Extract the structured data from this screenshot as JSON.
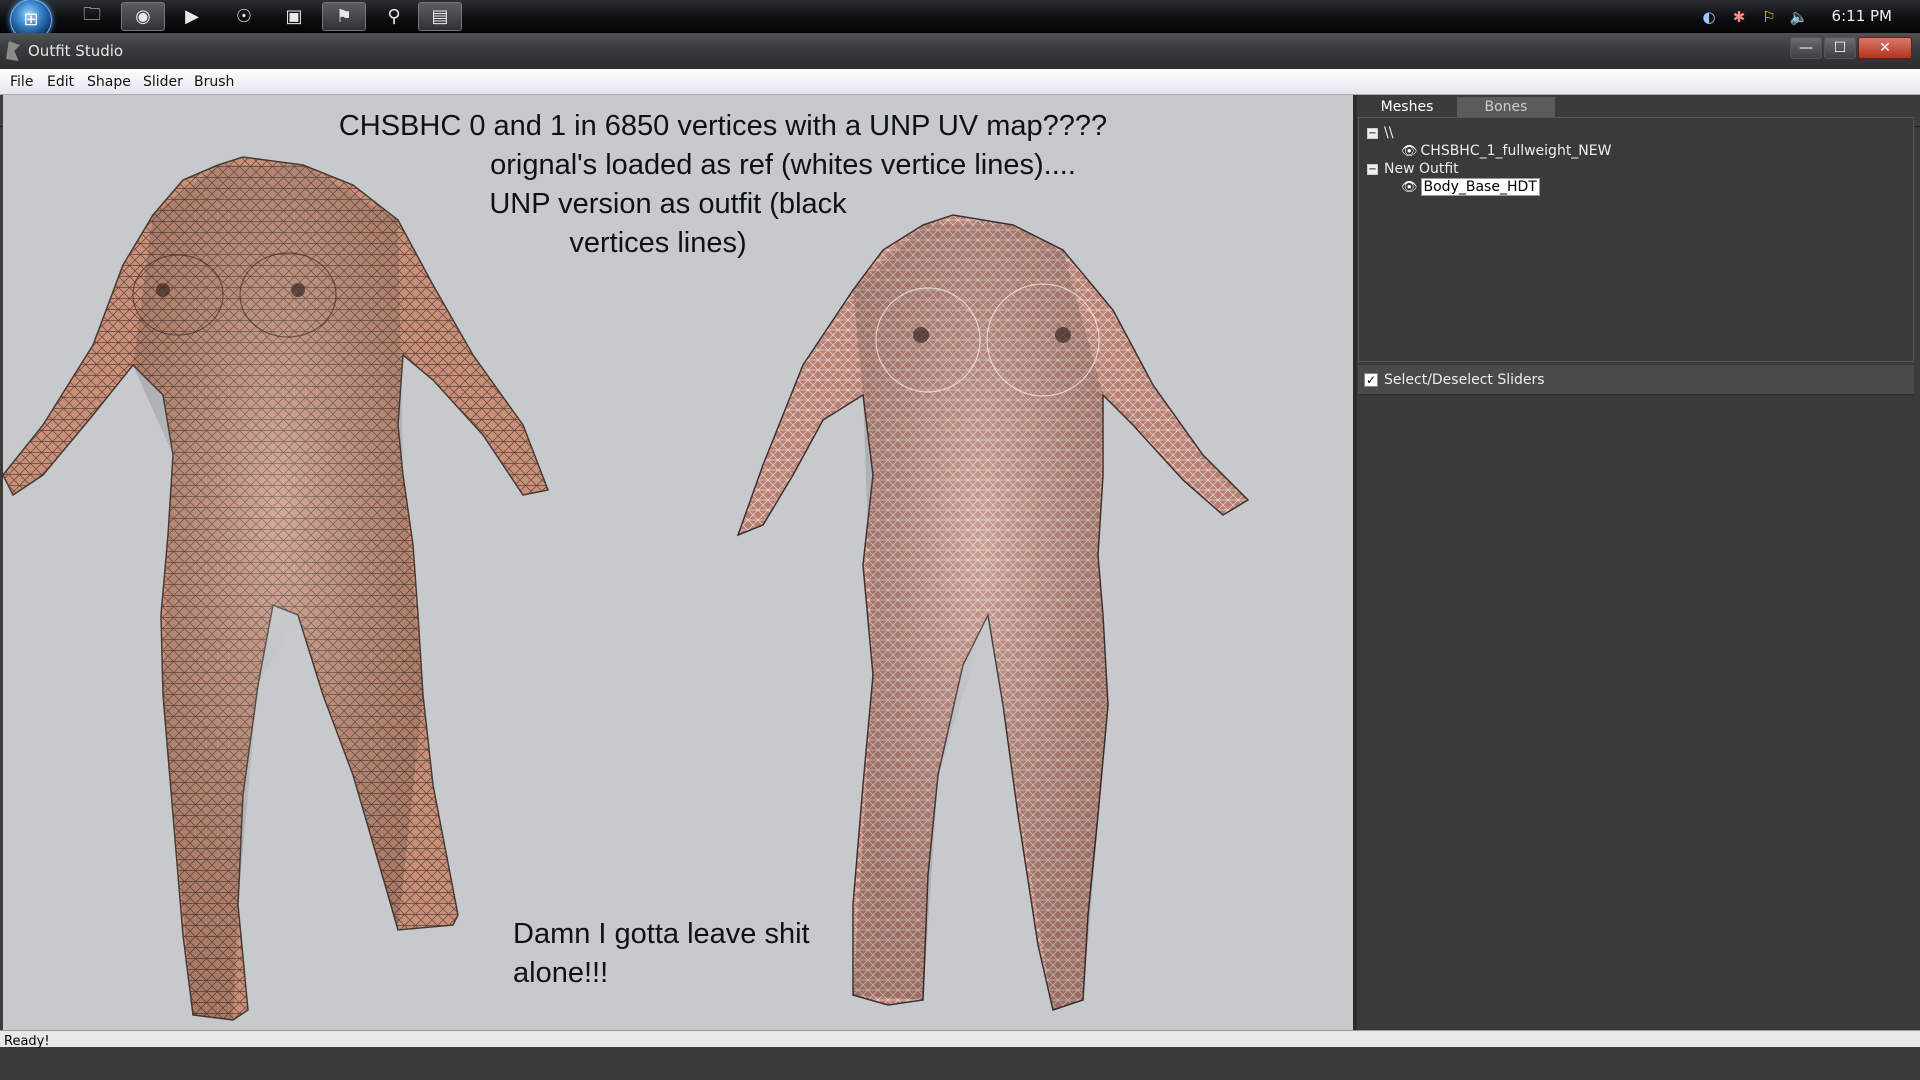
{
  "taskbar": {
    "start_icon": "windows-orb-icon",
    "pinned": [
      {
        "name": "file-explorer-icon",
        "glyph": "🗀"
      },
      {
        "name": "firefox-icon",
        "glyph": "◉"
      },
      {
        "name": "media-player-icon",
        "glyph": "▶"
      },
      {
        "name": "app-c-icon",
        "glyph": "☉"
      },
      {
        "name": "app-window-icon",
        "glyph": "▣"
      },
      {
        "name": "outfit-studio-icon",
        "glyph": "⚑"
      },
      {
        "name": "app-gear-icon",
        "glyph": "⚲"
      },
      {
        "name": "app-monitor-icon",
        "glyph": "▤"
      }
    ],
    "tray": [
      {
        "name": "steam-icon",
        "glyph": "◐"
      },
      {
        "name": "network-status-icon",
        "glyph": "✱"
      },
      {
        "name": "flag-icon",
        "glyph": "⚐"
      },
      {
        "name": "volume-icon",
        "glyph": "🔈"
      }
    ],
    "clock": "6:11 PM"
  },
  "window": {
    "title": "Outfit Studio",
    "controls": {
      "minimize": "—",
      "maximize": "☐",
      "close": "✕"
    }
  },
  "menu": [
    "File",
    "Edit",
    "Shape",
    "Slider",
    "Brush"
  ],
  "toolbar": [
    {
      "name": "load-reference-icon",
      "glyph": "⚑"
    },
    {
      "name": "load-outfit-icon",
      "glyph": "⚐"
    },
    {
      "name": "select-brush-icon",
      "glyph": "➶"
    },
    {
      "name": "mask-brush-icon",
      "glyph": "◪"
    },
    {
      "name": "inflate-brush-icon",
      "glyph": "●"
    },
    {
      "name": "deflate-brush-icon",
      "glyph": "◖"
    },
    {
      "name": "move-brush-icon",
      "glyph": "✥"
    },
    {
      "name": "smooth-brush-icon",
      "glyph": "⬤"
    },
    {
      "name": "weight-paint-icon",
      "glyph": "✎"
    }
  ],
  "viewport": {
    "annotation_top": [
      "CHSBHC 0 and 1 in 6850 vertices with a UNP UV map????",
      "orignal's loaded as ref (whites vertice lines)....",
      "UNP version as outfit (black",
      "vertices lines)"
    ],
    "annotation_bottom": [
      "Damn I gotta leave shit",
      "alone!!!"
    ],
    "colors": {
      "background": "#c7cacd",
      "skin": "#c98f78",
      "mesh_dark": "#3a2e2a",
      "mesh_light": "#f2eeee"
    }
  },
  "panel": {
    "tabs": [
      "Meshes",
      "Bones"
    ],
    "tree": {
      "root1": "\\\\",
      "ref_mesh": "CHSBHC_1_fullweight_NEW",
      "root2": "New Outfit",
      "outfit_mesh": "Body_Base_HDT"
    },
    "slider_toggle": "Select/Deselect Sliders"
  },
  "status": "Ready!"
}
